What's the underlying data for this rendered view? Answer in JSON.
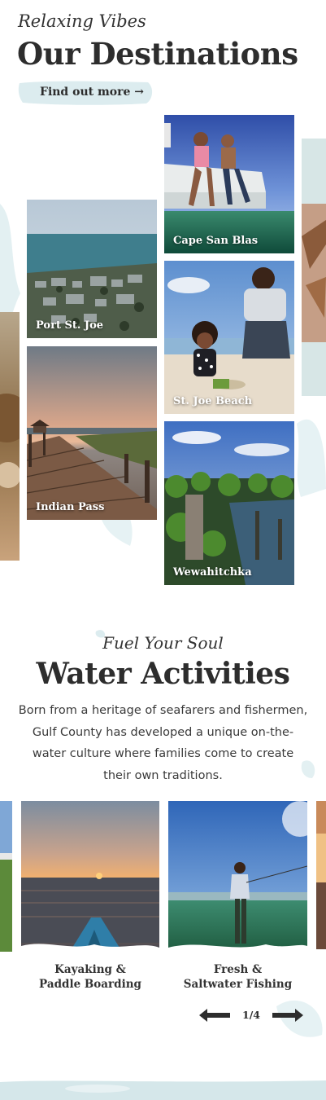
{
  "destinations_section": {
    "eyebrow": "Relaxing Vibes",
    "title": "Our Destinations",
    "cta_label": "Find out more →",
    "tiles": [
      {
        "label": "Cape San Blas"
      },
      {
        "label": "Port St. Joe"
      },
      {
        "label": "St. Joe Beach"
      },
      {
        "label": "Indian Pass"
      },
      {
        "label": "Wewahitchka"
      }
    ]
  },
  "activities_section": {
    "eyebrow": "Fuel Your Soul",
    "title": "Water Activities",
    "description": "Born from a heritage of seafarers and fishermen, Gulf County has developed a unique on-the-water culture where families come to create their own traditions.",
    "cards": [
      {
        "label_line1": "Kayaking &",
        "label_line2": "Paddle Boarding"
      },
      {
        "label_line1": "Fresh &",
        "label_line2": "Saltwater Fishing"
      }
    ],
    "pager": {
      "current": "1",
      "total": "4",
      "text": "1/4"
    }
  },
  "colors": {
    "accent_wash": "#d9ecee",
    "heading": "#2d2d2d"
  }
}
